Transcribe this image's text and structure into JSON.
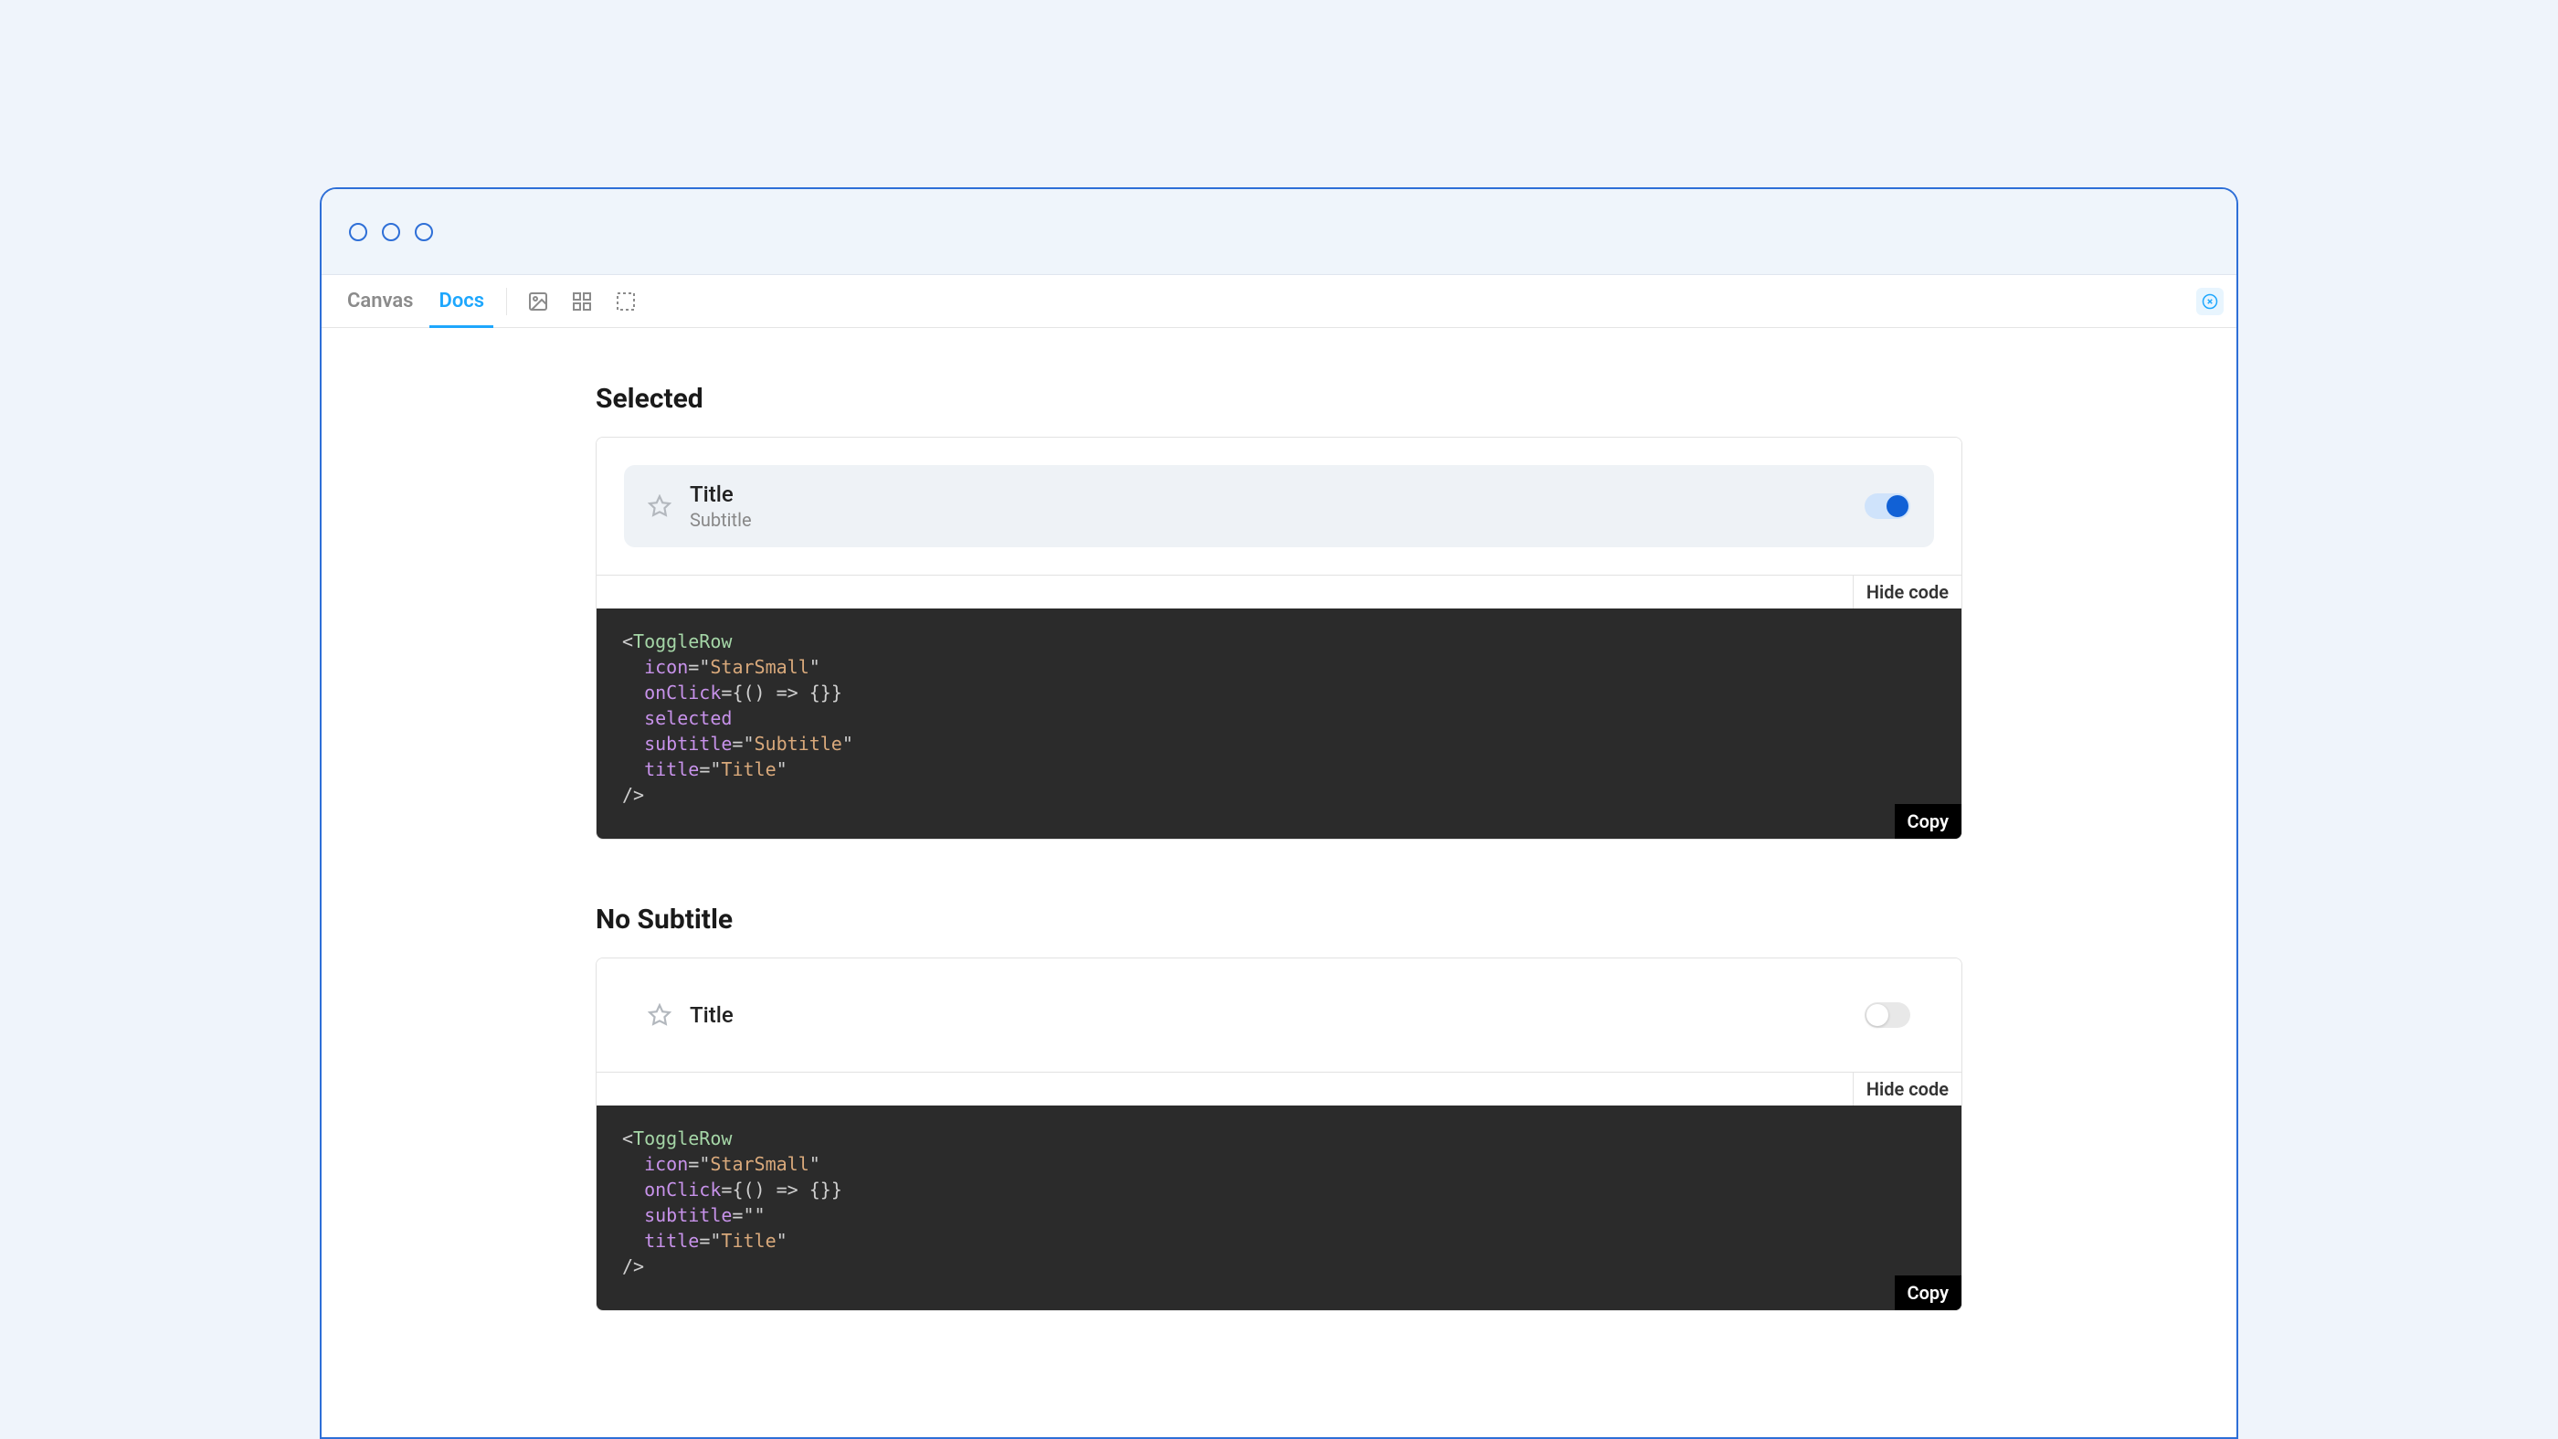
{
  "toolbar": {
    "tabs": {
      "canvas": "Canvas",
      "docs": "Docs"
    }
  },
  "sections": [
    {
      "heading": "Selected",
      "preview": {
        "title": "Title",
        "subtitle": "Subtitle",
        "selected": true,
        "toggled": true
      },
      "hide_code_label": "Hide code",
      "copy_label": "Copy",
      "code": {
        "tag": "ToggleRow",
        "props": [
          {
            "name": "icon",
            "value": "StarSmall",
            "kind": "string"
          },
          {
            "name": "onClick",
            "value": "() => {}",
            "kind": "expr"
          },
          {
            "name": "selected",
            "kind": "bool"
          },
          {
            "name": "subtitle",
            "value": "Subtitle",
            "kind": "string"
          },
          {
            "name": "title",
            "value": "Title",
            "kind": "string"
          }
        ]
      }
    },
    {
      "heading": "No Subtitle",
      "preview": {
        "title": "Title",
        "subtitle": "",
        "selected": false,
        "toggled": false
      },
      "hide_code_label": "Hide code",
      "copy_label": "Copy",
      "code": {
        "tag": "ToggleRow",
        "props": [
          {
            "name": "icon",
            "value": "StarSmall",
            "kind": "string"
          },
          {
            "name": "onClick",
            "value": "() => {}",
            "kind": "expr"
          },
          {
            "name": "subtitle",
            "value": "",
            "kind": "string"
          },
          {
            "name": "title",
            "value": "Title",
            "kind": "string"
          }
        ]
      }
    }
  ]
}
